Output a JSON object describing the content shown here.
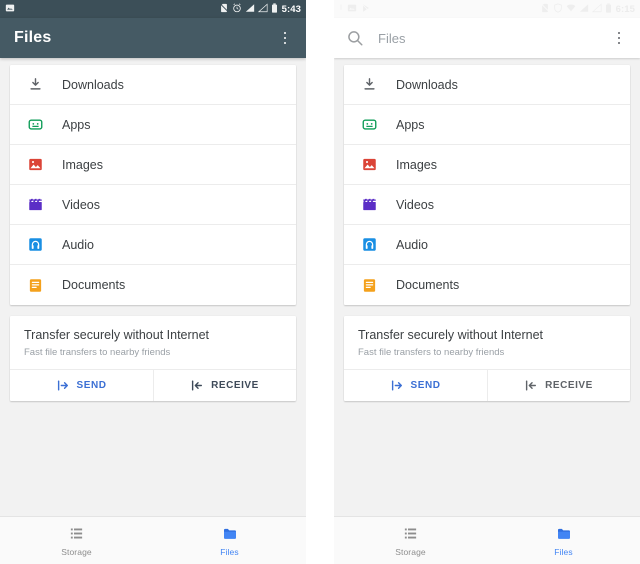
{
  "screens": [
    {
      "id": "left",
      "theme": "dark-appbar",
      "statusbar": {
        "time": "5:43",
        "left_icons": [
          "screenshot-icon"
        ],
        "right_icons": [
          "no-sim-icon",
          "alarm-icon",
          "signal-icon",
          "signal-off-icon",
          "battery-icon"
        ]
      },
      "appbar": {
        "type": "title",
        "title": "Files",
        "overflow_label": "More options"
      },
      "categories": [
        {
          "label": "Downloads",
          "icon": "download-icon",
          "color": "#5f6368"
        },
        {
          "label": "Apps",
          "icon": "android-icon",
          "color": "#0f9d58"
        },
        {
          "label": "Images",
          "icon": "image-icon",
          "color": "#db4437"
        },
        {
          "label": "Videos",
          "icon": "video-icon",
          "color": "#5b2ec6"
        },
        {
          "label": "Audio",
          "icon": "headphones-icon",
          "color": "#1a8fe3"
        },
        {
          "label": "Documents",
          "icon": "document-icon",
          "color": "#f4a11c"
        }
      ],
      "transfer": {
        "title": "Transfer securely without Internet",
        "subtitle": "Fast file transfers to nearby friends",
        "send_label": "SEND",
        "receive_label": "RECEIVE",
        "send_color": "#3b6fd4",
        "receive_color": "#3e4a59"
      },
      "bottom_nav": [
        {
          "label": "Storage",
          "icon": "storage-list-icon",
          "active": false,
          "color": "#8d8d8d"
        },
        {
          "label": "Files",
          "icon": "folder-icon",
          "active": true,
          "color": "#4285f4"
        }
      ]
    },
    {
      "id": "right",
      "theme": "light-searchbar",
      "statusbar": {
        "time": "6:15",
        "left_icons": [
          "notification-dot-icon",
          "screenshot-icon",
          "play-icon"
        ],
        "right_icons": [
          "no-sim-icon",
          "shield-icon",
          "wifi-icon",
          "signal-icon",
          "signal-off-icon",
          "battery-icon"
        ]
      },
      "appbar": {
        "type": "search",
        "search_icon": "search-icon",
        "placeholder": "Files",
        "overflow_label": "More options"
      },
      "categories": [
        {
          "label": "Downloads",
          "icon": "download-icon",
          "color": "#5f6368"
        },
        {
          "label": "Apps",
          "icon": "android-icon",
          "color": "#0f9d58"
        },
        {
          "label": "Images",
          "icon": "image-icon",
          "color": "#db4437"
        },
        {
          "label": "Videos",
          "icon": "video-icon",
          "color": "#5b2ec6"
        },
        {
          "label": "Audio",
          "icon": "headphones-icon",
          "color": "#1a8fe3"
        },
        {
          "label": "Documents",
          "icon": "document-icon",
          "color": "#f4a11c"
        }
      ],
      "transfer": {
        "title": "Transfer securely without Internet",
        "subtitle": "Fast file transfers to nearby friends",
        "send_label": "SEND",
        "receive_label": "RECEIVE",
        "send_color": "#3b6fd4",
        "receive_color": "#5f6368"
      },
      "bottom_nav": [
        {
          "label": "Storage",
          "icon": "storage-list-icon",
          "active": false,
          "color": "#8d8d8d"
        },
        {
          "label": "Files",
          "icon": "folder-icon",
          "active": true,
          "color": "#4285f4"
        }
      ]
    }
  ],
  "theme": {
    "appbar_dark": "#455a64",
    "statusbar_dark": "#3c4f58",
    "page_background": "#f2f2f2",
    "card_background": "#ffffff",
    "accent_blue": "#4285f4",
    "text_primary": "#3c4043",
    "text_secondary": "#9aa0a6"
  }
}
